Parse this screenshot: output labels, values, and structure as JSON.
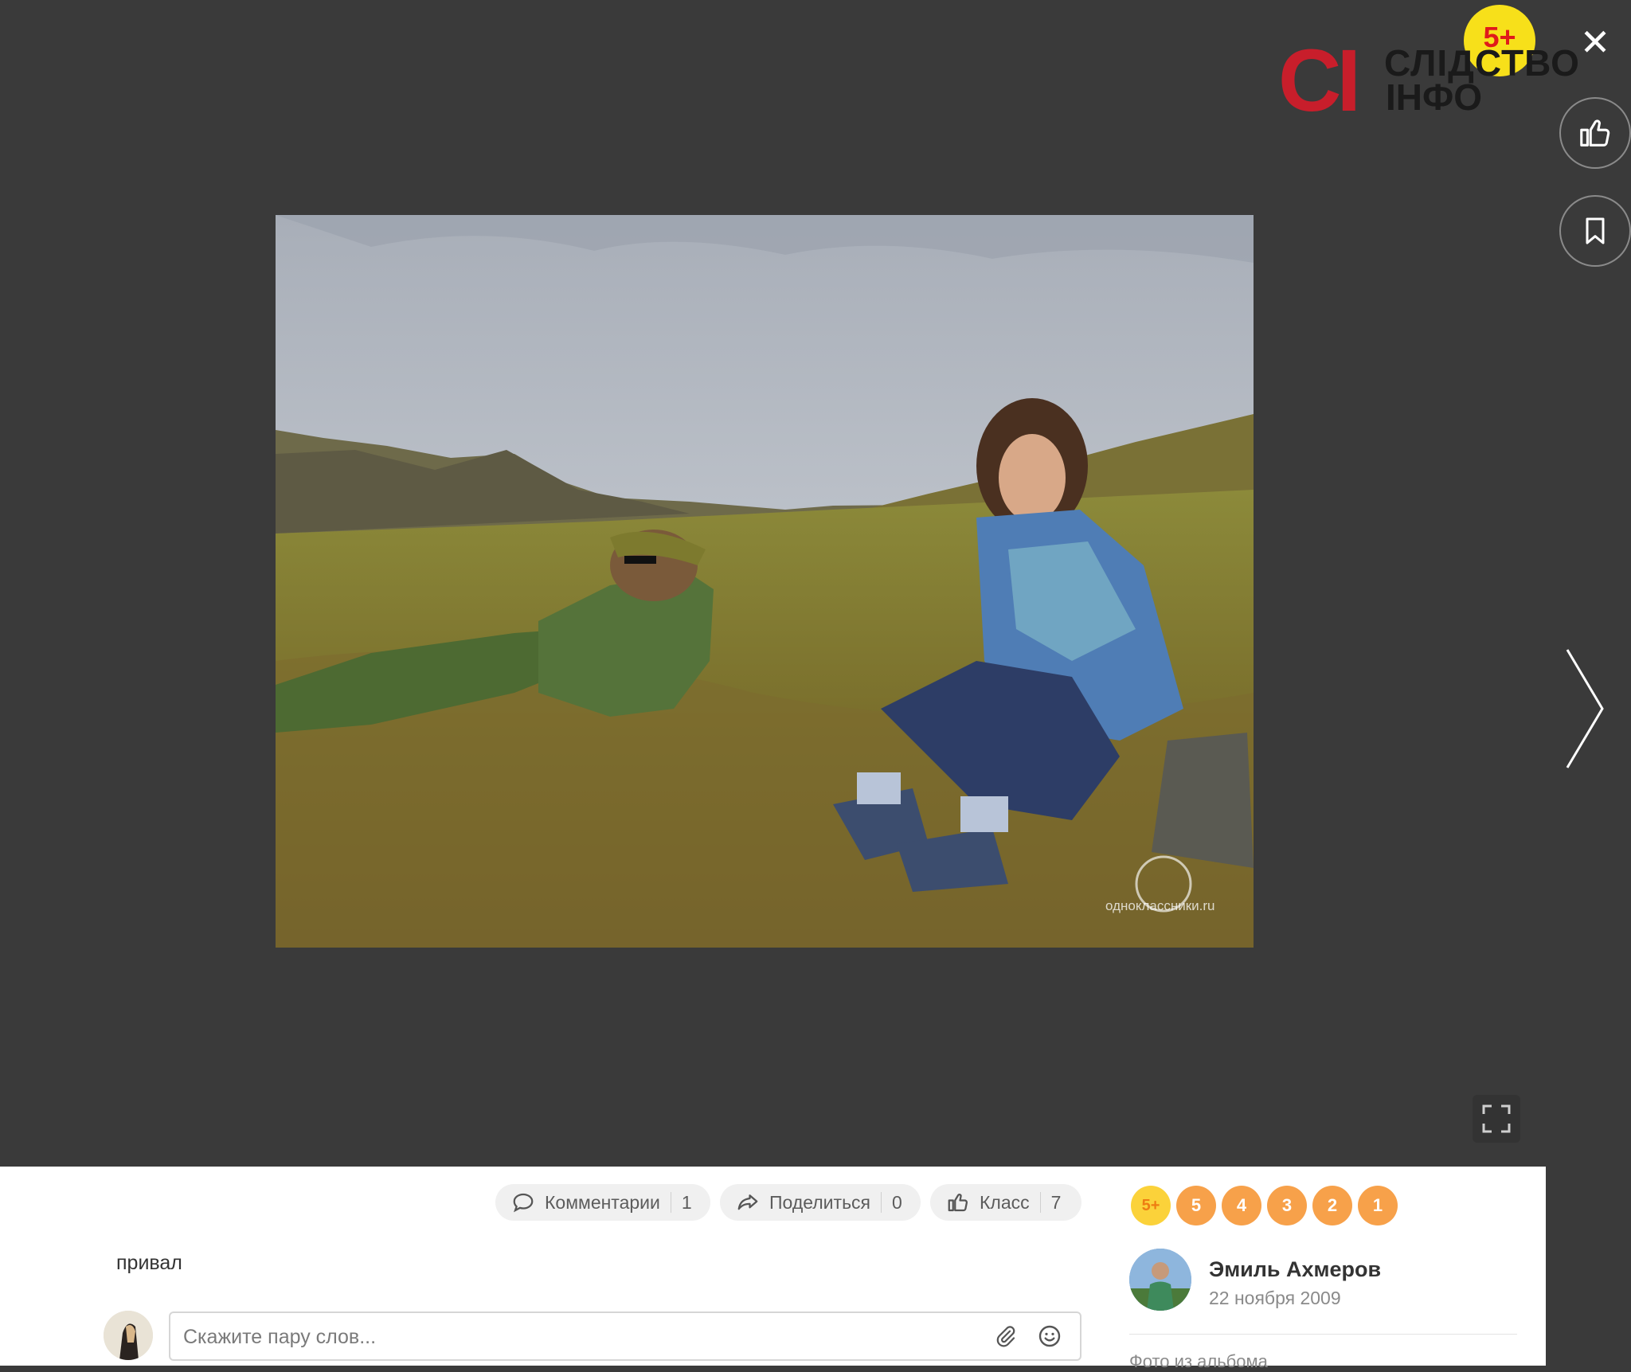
{
  "viewer": {
    "close_symbol": "✕",
    "photo_watermark": "одноклассники.ru"
  },
  "overlay_logo": {
    "age_badge": "5+",
    "brand_short": "СІ",
    "brand_line1": "СЛІДСТВО",
    "brand_line2": "ІНФО"
  },
  "actions": {
    "comments": {
      "label": "Комментарии",
      "count": "1",
      "icon": "speech-bubble-icon"
    },
    "share": {
      "label": "Поделиться",
      "count": "0",
      "icon": "share-arrow-icon"
    },
    "like": {
      "label": "Класс",
      "count": "7",
      "icon": "thumbs-up-icon"
    }
  },
  "caption": "привал",
  "comment": {
    "placeholder": "Скажите пару слов..."
  },
  "ratings": [
    "5+",
    "5",
    "4",
    "3",
    "2",
    "1"
  ],
  "author": {
    "name": "Эмиль Ахмеров",
    "date": "22 ноября 2009"
  },
  "album_label": "Фото из альбома",
  "colors": {
    "viewer_bg": "#3a3a3a",
    "rating_orange": "#f7a14a",
    "rating_plus": "#fbd23a",
    "logo_red": "#c81e2b"
  }
}
